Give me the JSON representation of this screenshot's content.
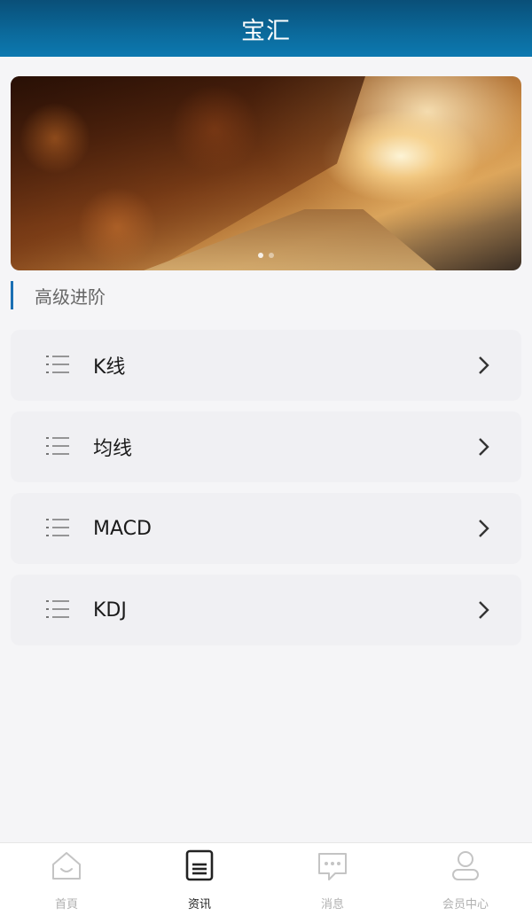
{
  "header": {
    "title": "宝汇"
  },
  "banner": {
    "slide_count": 2,
    "active_slide": 0
  },
  "section": {
    "title": "高级进阶"
  },
  "menu": {
    "items": [
      {
        "label": "K线",
        "icon": "list-icon"
      },
      {
        "label": "均线",
        "icon": "list-icon"
      },
      {
        "label": "MACD",
        "icon": "list-icon"
      },
      {
        "label": "KDJ",
        "icon": "list-icon"
      }
    ]
  },
  "tabbar": {
    "tabs": [
      {
        "label": "首頁",
        "icon": "home-icon",
        "active": false
      },
      {
        "label": "资讯",
        "icon": "news-icon",
        "active": true
      },
      {
        "label": "消息",
        "icon": "message-icon",
        "active": false
      },
      {
        "label": "会员中心",
        "icon": "user-icon",
        "active": false
      }
    ]
  },
  "colors": {
    "header": "#0b6a9c",
    "accent": "#1a6fb3"
  }
}
